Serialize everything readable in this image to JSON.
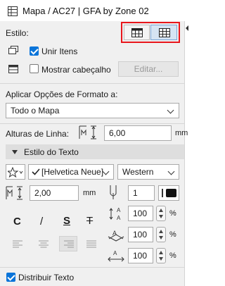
{
  "window": {
    "title": "Mapa / AC27 | GFA by Zone 02"
  },
  "style": {
    "label": "Estilo:",
    "merge_items_label": "Unir Itens",
    "show_header_label": "Mostrar cabeçalho",
    "edit_button": "Editar..."
  },
  "format": {
    "apply_label": "Aplicar Opções de Formato a:",
    "apply_value": "Todo o Mapa",
    "row_height_label": "Alturas de Linha:",
    "row_height_value": "6,00",
    "row_height_unit": "mm"
  },
  "text_style": {
    "section_title": "Estilo do Texto",
    "font_value": "[Helvetica Neue]",
    "script_value": "Western",
    "size_value": "2,00",
    "size_unit": "mm",
    "pen_value": "1",
    "bold": "C",
    "italic": "/",
    "underline": "S",
    "strike": "T",
    "width_factor": "100",
    "spacing_factor": "100",
    "slant_factor": "100",
    "percent": "%"
  },
  "footer": {
    "distribute_text_label": "Distribuir Texto"
  },
  "colors": {
    "accent": "#0a74d9",
    "highlight": "#e8161c",
    "panel": "#f0f0f0",
    "section": "#dedede"
  }
}
